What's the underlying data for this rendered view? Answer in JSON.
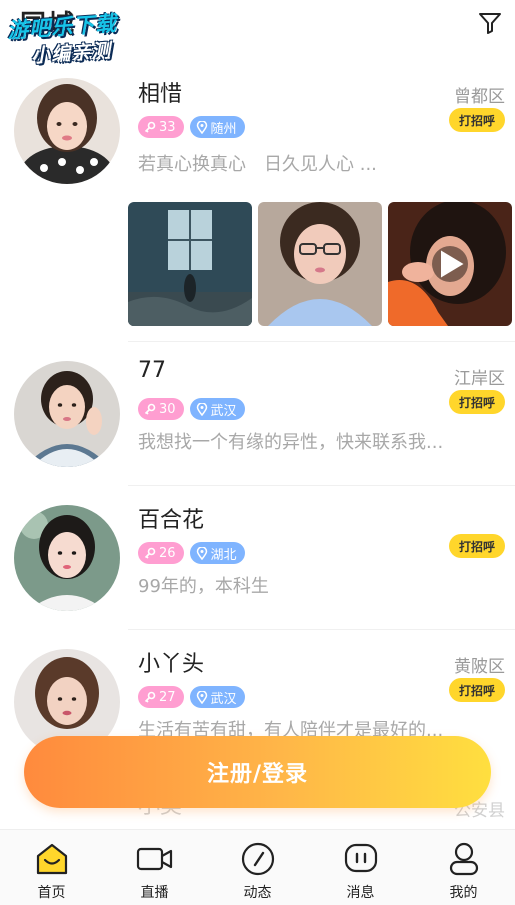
{
  "header": {
    "title": "同城",
    "watermark_line1": "游吧乐下载",
    "watermark_line2": "小编亲测",
    "filter_icon": "filter-icon"
  },
  "colors": {
    "accent_yellow": "#ffd62b",
    "age_tag": "#ff9ed1",
    "location_tag": "#7fb4ff",
    "cta_gradient_start": "#ff8a3d",
    "cta_gradient_end": "#ffdf3f",
    "muted_text": "#a8a8a8"
  },
  "feed": [
    {
      "name": "相惜",
      "age": "33",
      "location": "随州",
      "district": "曾都区",
      "bio": "若真心换真心　日久见人心 ...",
      "greet": "打招呼",
      "photos": 3
    },
    {
      "name": "77",
      "age": "30",
      "location": "武汉",
      "district": "江岸区",
      "bio": "我想找一个有缘的异性，快来联系我...",
      "greet": "打招呼"
    },
    {
      "name": "百合花",
      "age": "26",
      "location": "湖北",
      "district": "",
      "bio": "99年的，本科生",
      "greet": "打招呼"
    },
    {
      "name": "小丫头",
      "age": "27",
      "location": "武汉",
      "district": "黄陂区",
      "bio": "生活有苦有甜，有人陪伴才是最好的...",
      "greet": "打招呼"
    },
    {
      "name": "小美",
      "district": "公安县"
    }
  ],
  "cta": {
    "label": "注册/登录"
  },
  "bottom_nav": [
    {
      "label": "首页",
      "icon": "home-icon"
    },
    {
      "label": "直播",
      "icon": "video-camera-icon"
    },
    {
      "label": "动态",
      "icon": "compass-icon"
    },
    {
      "label": "消息",
      "icon": "message-icon"
    },
    {
      "label": "我的",
      "icon": "profile-icon"
    }
  ]
}
